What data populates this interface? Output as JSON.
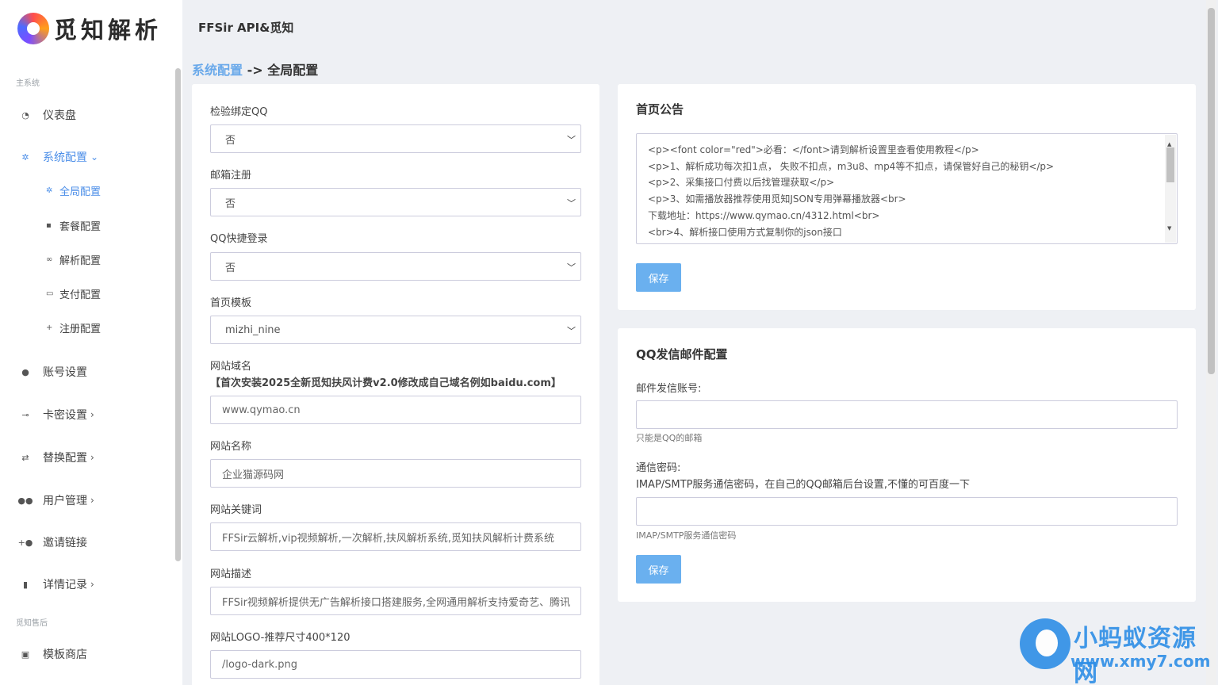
{
  "brand": {
    "logo_text": "觅知解析"
  },
  "app_title": "FFSir API&觅知",
  "breadcrumb": {
    "parent": "系统配置",
    "separator": "->",
    "current": "全局配置"
  },
  "sidebar": {
    "section_main": "主系统",
    "section_after": "觅知售后",
    "items": [
      {
        "label": "仪表盘",
        "icon": "gauge-icon"
      },
      {
        "label": "系统配置",
        "icon": "gear-icon",
        "chevron": "⌄"
      },
      {
        "label": "账号设置",
        "icon": "user-icon"
      },
      {
        "label": "卡密设置",
        "icon": "key-icon",
        "chevron": "›"
      },
      {
        "label": "替换配置",
        "icon": "swap-icon",
        "chevron": "›"
      },
      {
        "label": "用户管理",
        "icon": "users-icon",
        "chevron": "›"
      },
      {
        "label": "邀请链接",
        "icon": "user-plus-icon"
      },
      {
        "label": "详情记录",
        "icon": "clipboard-icon",
        "chevron": "›"
      },
      {
        "label": "模板商店",
        "icon": "store-icon"
      }
    ],
    "sub_items": [
      {
        "label": "全局配置",
        "icon": "gear-icon"
      },
      {
        "label": "套餐配置",
        "icon": "bag-icon"
      },
      {
        "label": "解析配置",
        "icon": "link-icon"
      },
      {
        "label": "支付配置",
        "icon": "card-icon"
      },
      {
        "label": "注册配置",
        "icon": "user-plus-icon"
      }
    ]
  },
  "form": {
    "qq_bind": {
      "label": "检验绑定QQ",
      "value": "否"
    },
    "email_register": {
      "label": "邮箱注册",
      "value": "否"
    },
    "qq_login": {
      "label": "QQ快捷登录",
      "value": "否"
    },
    "home_template": {
      "label": "首页模板",
      "value": "mizhi_nine"
    },
    "site_domain": {
      "label": "网站域名",
      "hint": "【首次安装2025全新觅知扶风计费v2.0修改成自己域名例如baidu.com】",
      "value": "www.qymao.cn"
    },
    "site_name": {
      "label": "网站名称",
      "value": "企业猫源码网"
    },
    "site_keywords": {
      "label": "网站关键词",
      "value": "FFSir云解析,vip视频解析,一次解析,扶风解析系统,觅知扶风解析计费系统"
    },
    "site_description": {
      "label": "网站描述",
      "value": "FFSir视频解析提供无广告解析接口搭建服务,全网通用解析支持爱奇艺、腾讯"
    },
    "site_logo": {
      "label": "网站LOGO-推荐尺寸400*120",
      "value": "/logo-dark.png"
    }
  },
  "notice": {
    "title": "首页公告",
    "lines": [
      "<p><font color=\"red\">必看：</font>请到解析设置里查看使用教程</p>",
      "<p>1、解析成功每次扣1点， 失败不扣点，m3u8、mp4等不扣点，请保管好自己的秘钥</p>",
      "<p>2、采集接口付费以后找管理获取</p>",
      "<p>3、如需播放器推荐使用觅知JSON专用弹幕播放器<br>",
      "下载地址：https://www.qymao.cn/4312.html<br>",
      "<br>4、解析接口使用方式复制你的json接口"
    ],
    "save_label": "保存"
  },
  "mail": {
    "title": "QQ发信邮件配置",
    "account_label": "邮件发信账号:",
    "account_value": "",
    "account_hint": "只能是QQ的邮箱",
    "password_label": "通信密码:",
    "password_desc": "IMAP/SMTP服务通信密码，在自己的QQ邮箱后台设置,不懂的可百度一下",
    "password_value": "",
    "password_hint": "IMAP/SMTP服务通信密码",
    "save_label": "保存"
  },
  "watermark": {
    "title": "小蚂蚁资源网",
    "url": "www.xmy7.com"
  }
}
